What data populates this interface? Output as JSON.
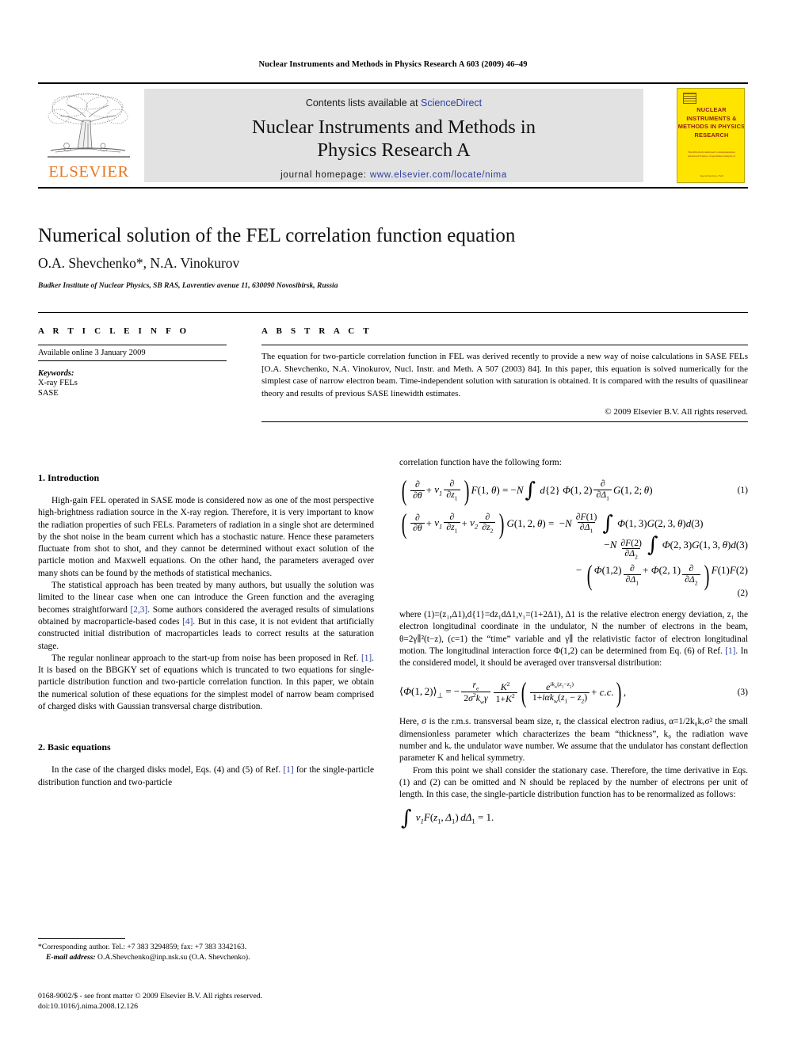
{
  "runhead": "Nuclear Instruments and Methods in Physics Research A 603 (2009) 46–49",
  "masthead": {
    "publisher_name": "ELSEVIER",
    "contents_prefix": "Contents lists available at ",
    "contents_link": "ScienceDirect",
    "journal_title_line1": "Nuclear Instruments and Methods in",
    "journal_title_line2": "Physics Research A",
    "homepage_label": "journal homepage: ",
    "homepage_url": "www.elsevier.com/locate/nima",
    "cover": {
      "title": "NUCLEAR INSTRUMENTS & METHODS IN PHYSICS RESEARCH",
      "subtitle": "The fifth‑field, dedicated to instrumentation Advanced Science of specialized analysis of",
      "footer": "Special Section / Full"
    },
    "link_color": "#2B3FA0",
    "elsevier_orange": "#E87722",
    "cover_yellow": "#FFE400"
  },
  "article": {
    "title": "Numerical solution of the FEL correlation function equation",
    "authors": "O.A. Shevchenko*, N.A. Vinokurov",
    "affiliation": "Budker Institute of Nuclear Physics, SB RAS, Lavrentiev avenue 11, 630090 Novosibirsk, Russia"
  },
  "article_info": {
    "heading": "A R T I C L E  I N F O",
    "available_online": "Available online 3 January 2009",
    "keywords_label": "Keywords:",
    "keywords": [
      "X-ray FELs",
      "SASE"
    ]
  },
  "abstract": {
    "heading": "A B S T R A C T",
    "text": "The equation for two-particle correlation function in FEL was derived recently to provide a new way of noise calculations in SASE FELs [O.A. Shevchenko, N.A. Vinokurov, Nucl. Instr. and Meth. A 507 (2003) 84]. In this paper, this equation is solved numerically for the simplest case of narrow electron beam. Time-independent solution with saturation is obtained. It is compared with the results of quasilinear theory and results of previous SASE linewidth estimates.",
    "rights": "© 2009 Elsevier B.V. All rights reserved."
  },
  "sections": {
    "introduction": {
      "heading": "1.  Introduction",
      "p1": "High-gain FEL operated in SASE mode is considered now as one of the most perspective high-brightness radiation source in the X-ray region. Therefore, it is very important to know the radiation properties of such FELs. Parameters of radiation in a single shot are determined by the shot noise in the beam current which has a stochastic nature. Hence these parameters fluctuate from shot to shot, and they cannot be determined without exact solution of the particle motion and Maxwell equations. On the other hand, the parameters averaged over many shots can be found by the methods of statistical mechanics.",
      "p2a": "The statistical approach has been treated by many authors, but usually the solution was limited to the linear case when one can introduce the Green function and the averaging becomes straightforward ",
      "p2_cite1": "[2,3]",
      "p2b": ". Some authors considered the averaged results of simulations obtained by macroparticle-based codes ",
      "p2_cite2": "[4]",
      "p2c": ". But in this case, it is not evident that artificially constructed initial distribution of macroparticles leads to correct results at the saturation stage.",
      "p3a": "The regular nonlinear approach to the start-up from noise has been proposed in Ref. ",
      "p3_cite": "[1]",
      "p3b": ". It is based on the BBGKY set of equations which is truncated to two equations for single-particle distribution function and two-particle correlation function. In this paper, we obtain the numerical solution of these equations for the simplest model of narrow beam comprised of charged disks with Gaussian transversal charge distribution."
    },
    "basic_equations": {
      "heading": "2.  Basic equations",
      "p1a": "In the case of the charged disks model, Eqs. (4) and (5) of Ref. ",
      "p1_cite": "[1]",
      "p1b": " for the single-particle distribution function and two-particle",
      "cont": "correlation function have the following form:",
      "where_text_a": "where (1)=(z₁,Δ1),d{1}=dz₁dΔ1,ν₁=(1+2Δ1), Δ1 is the relative electron energy deviation, z₁ the electron longitudinal coordinate in the undulator, N the number of electrons in the beam, θ=2γ∥²(t−z), (c=1) the “time” variable and γ∥ the relativistic factor of electron longitudinal motion. The longitudinal interaction force Φ(1,2) can be determined from Eq. (6) of Ref. ",
      "where_cite": "[1]",
      "where_text_b": ". In the considered model, it should be averaged over transversal distribution:",
      "after_eq3": "Here, σ is the r.m.s. transversal beam size, rₑ the classical electron radius, α=1/2k₀kᵥσ² the small dimensionless parameter which characterizes the beam “thickness”, k₀ the radiation wave number and kᵥ the undulator wave number. We assume that the undulator has constant deflection parameter K and helical symmetry.",
      "stationary": "From this point we shall consider the stationary case. Therefore, the time derivative in Eqs. (1) and (2) can be omitted and N should be replaced by the number of electrons per unit of length. In this case, the single-particle distribution function has to be renormalized as follows:"
    }
  },
  "equations": {
    "eq1_tag": "(1)",
    "eq2_tag": "(2)",
    "eq3_tag": "(3)"
  },
  "footnote": {
    "corresponding": "*Corresponding author. Tel.: +7 383 3294859; fax: +7 383 3342163.",
    "email_label": "E-mail address:",
    "email": "O.A.Shevchenko@inp.nsk.su (O.A. Shevchenko)."
  },
  "imprint": {
    "line1": "0168-9002/$ - see front matter © 2009 Elsevier B.V. All rights reserved.",
    "line2": "doi:10.1016/j.nima.2008.12.126"
  }
}
